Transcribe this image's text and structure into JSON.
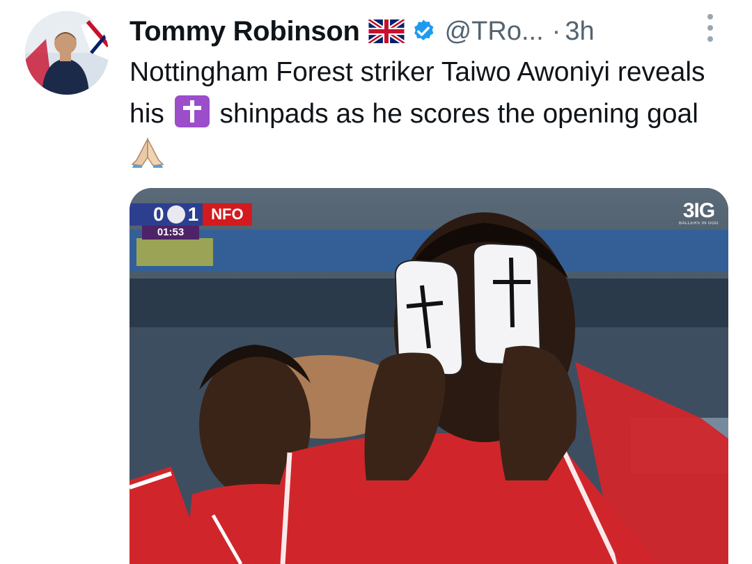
{
  "author": {
    "name": "Tommy Robinson",
    "flag_icon": "uk-flag-icon",
    "verified_icon": "verified-badge-icon",
    "handle": "@TRo...",
    "separator": "·",
    "time": "3h"
  },
  "tweet": {
    "text_part1": "Nottingham Forest striker Taiwo Awoniyi reveals his",
    "text_part2": " shinpads as he scores the opening goal",
    "emoji_1": "latin-cross-emoji",
    "emoji_2": "folded-hands-emoji"
  },
  "media": {
    "scoreboard": {
      "home_score": "0",
      "separator": "-",
      "away_score": "1",
      "away_team": "NFO",
      "clock": "01:53"
    },
    "brand": {
      "logo": "3IG",
      "tagline": "BALLERS IN GOD"
    }
  },
  "colors": {
    "text": "#0f1419",
    "secondary": "#536471",
    "verified": "#1d9bf0",
    "emoji_purple": "#9b4dca",
    "kit_red": "#d21a1f"
  }
}
